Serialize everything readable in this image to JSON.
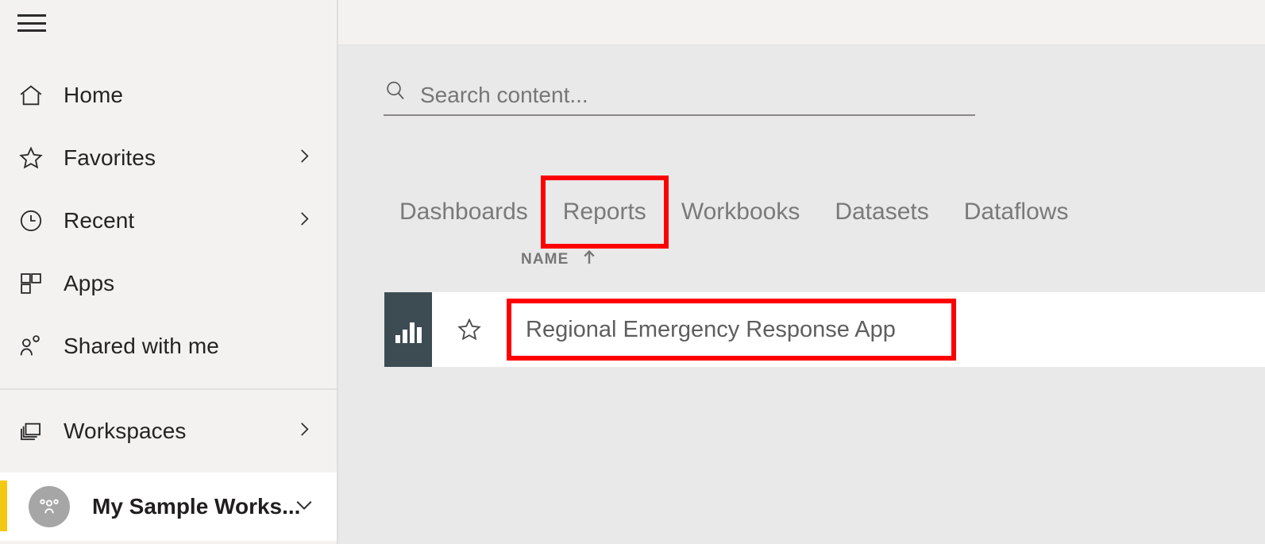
{
  "sidebar": {
    "menu_button": "menu-hamburger",
    "items": [
      {
        "label": "Home",
        "icon": "home-icon",
        "has_chevron": false
      },
      {
        "label": "Favorites",
        "icon": "star-icon",
        "has_chevron": true
      },
      {
        "label": "Recent",
        "icon": "clock-icon",
        "has_chevron": true
      },
      {
        "label": "Apps",
        "icon": "apps-grid-icon",
        "has_chevron": false
      },
      {
        "label": "Shared with me",
        "icon": "people-share-icon",
        "has_chevron": false
      }
    ],
    "workspaces": {
      "label": "Workspaces",
      "icon": "stacked-windows-icon",
      "has_chevron": true
    },
    "selected_workspace": {
      "label": "My Sample Works...",
      "avatar_icon": "group-people-icon",
      "chevron": "chevron-down-icon",
      "accent_color": "#f2c811"
    }
  },
  "search": {
    "placeholder": "Search content...",
    "value": "",
    "icon": "search-icon"
  },
  "tabs": [
    {
      "label": "Dashboards",
      "highlighted": false
    },
    {
      "label": "Reports",
      "highlighted": true
    },
    {
      "label": "Workbooks",
      "highlighted": false
    },
    {
      "label": "Datasets",
      "highlighted": false
    },
    {
      "label": "Dataflows",
      "highlighted": false
    }
  ],
  "list": {
    "column_header": "NAME",
    "sort_direction": "ascending",
    "sort_icon": "arrow-up-icon",
    "rows": [
      {
        "title": "Regional Emergency Response App",
        "thumbnail_icon": "bar-chart-report-icon",
        "thumbnail_color": "#3d4c52",
        "favorite_icon": "star-outline-icon",
        "favorited": false,
        "highlighted": true
      }
    ]
  },
  "annotations": {
    "highlight_color": "#ff0000",
    "targets": [
      "Reports",
      "Regional Emergency Response App"
    ]
  }
}
